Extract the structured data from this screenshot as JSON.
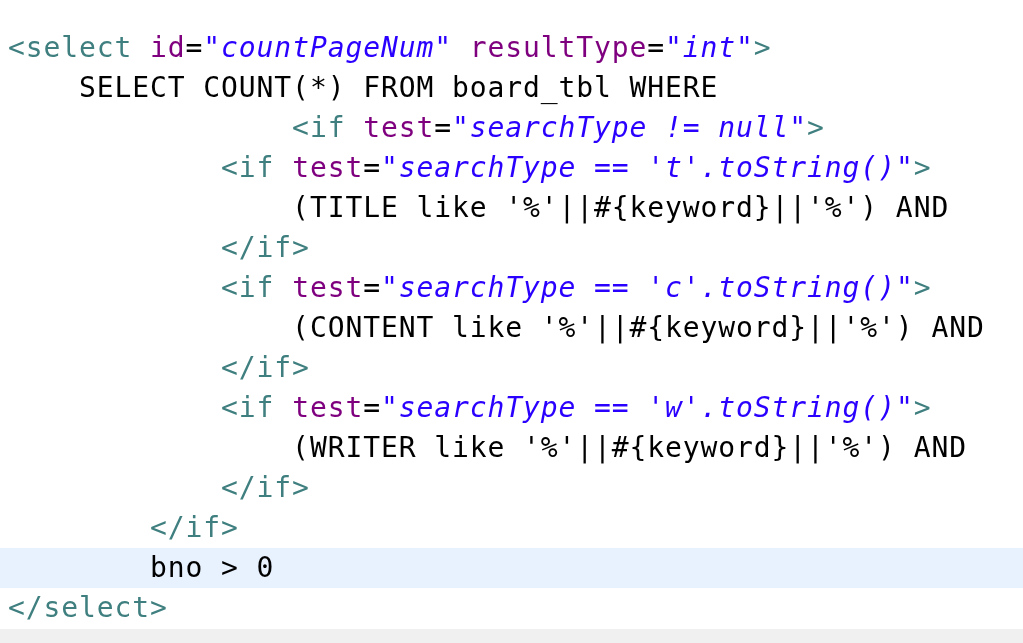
{
  "editor": {
    "lines": [
      {
        "current": false,
        "tokens": [
          {
            "kind": "tag",
            "text": "<select "
          },
          {
            "kind": "attr",
            "text": "id"
          },
          {
            "kind": "text",
            "text": "="
          },
          {
            "kind": "string",
            "text": "\"countPageNum\" "
          },
          {
            "kind": "attr",
            "text": "resultType"
          },
          {
            "kind": "text",
            "text": "="
          },
          {
            "kind": "string",
            "text": "\"int\""
          },
          {
            "kind": "tag",
            "text": ">"
          }
        ]
      },
      {
        "current": false,
        "tokens": [
          {
            "kind": "text",
            "text": "    SELECT COUNT(*) FROM board_tbl WHERE"
          }
        ]
      },
      {
        "current": false,
        "tokens": [
          {
            "kind": "tag",
            "text": "                <if "
          },
          {
            "kind": "attr",
            "text": "test"
          },
          {
            "kind": "text",
            "text": "="
          },
          {
            "kind": "string",
            "text": "\"searchType != null\""
          },
          {
            "kind": "tag",
            "text": ">"
          }
        ]
      },
      {
        "current": false,
        "tokens": [
          {
            "kind": "tag",
            "text": "            <if "
          },
          {
            "kind": "attr",
            "text": "test"
          },
          {
            "kind": "text",
            "text": "="
          },
          {
            "kind": "string",
            "text": "\"searchType == 't'.toString()\""
          },
          {
            "kind": "tag",
            "text": ">"
          }
        ]
      },
      {
        "current": false,
        "tokens": [
          {
            "kind": "text",
            "text": "                (TITLE like '%'||#{keyword}||'%') AND"
          }
        ]
      },
      {
        "current": false,
        "tokens": [
          {
            "kind": "tag",
            "text": "            </if>"
          }
        ]
      },
      {
        "current": false,
        "tokens": [
          {
            "kind": "tag",
            "text": "            <if "
          },
          {
            "kind": "attr",
            "text": "test"
          },
          {
            "kind": "text",
            "text": "="
          },
          {
            "kind": "string",
            "text": "\"searchType == 'c'.toString()\""
          },
          {
            "kind": "tag",
            "text": ">"
          }
        ]
      },
      {
        "current": false,
        "tokens": [
          {
            "kind": "text",
            "text": "                (CONTENT like '%'||#{keyword}||'%') AND"
          }
        ]
      },
      {
        "current": false,
        "tokens": [
          {
            "kind": "tag",
            "text": "            </if>"
          }
        ]
      },
      {
        "current": false,
        "tokens": [
          {
            "kind": "tag",
            "text": "            <if "
          },
          {
            "kind": "attr",
            "text": "test"
          },
          {
            "kind": "text",
            "text": "="
          },
          {
            "kind": "string",
            "text": "\"searchType == 'w'.toString()\""
          },
          {
            "kind": "tag",
            "text": ">"
          }
        ]
      },
      {
        "current": false,
        "tokens": [
          {
            "kind": "text",
            "text": "                (WRITER like '%'||#{keyword}||'%') AND"
          }
        ]
      },
      {
        "current": false,
        "tokens": [
          {
            "kind": "tag",
            "text": "            </if>"
          }
        ]
      },
      {
        "current": false,
        "tokens": [
          {
            "kind": "tag",
            "text": "        </if>"
          }
        ]
      },
      {
        "current": true,
        "tokens": [
          {
            "kind": "text",
            "text": "        bno > 0"
          }
        ]
      },
      {
        "current": false,
        "tokens": [
          {
            "kind": "tag",
            "text": "</select>"
          }
        ]
      }
    ]
  }
}
